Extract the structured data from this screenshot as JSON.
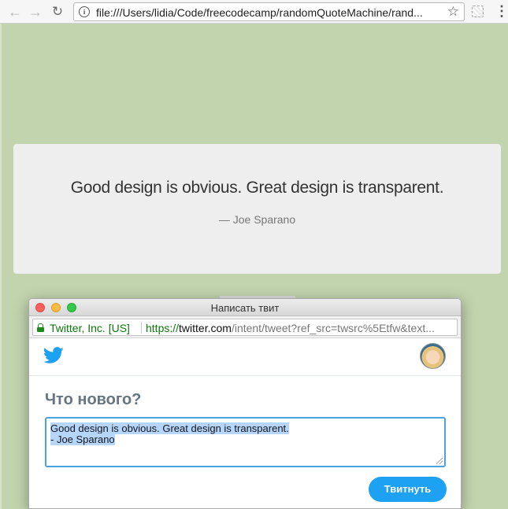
{
  "browser": {
    "url": "file:///Users/lidia/Code/freecodecamp/randomQuoteMachine/rand...",
    "icons": [
      "back-arrow-icon",
      "forward-arrow-icon",
      "reload-icon",
      "info-icon",
      "star-icon",
      "extension-icon",
      "menu-icon"
    ]
  },
  "quote": {
    "text": "Good design is obvious. Great design is transparent.",
    "author": "— Joe Sparano"
  },
  "popup": {
    "title": "Написать твит",
    "security_org": "Twitter, Inc. [US]",
    "url_scheme": "https://",
    "url_host": "twitter.com",
    "url_rest": "/intent/tweet?ref_src=twsrc%5Etfw&text...",
    "heading": "Что нового?",
    "tweet_line1": "Good design is obvious. Great design is transparent. ",
    "tweet_line2": " ",
    "tweet_line3": " - Joe Sparano",
    "button_label": "Твитнуть",
    "brand_color": "#1da1f2"
  }
}
